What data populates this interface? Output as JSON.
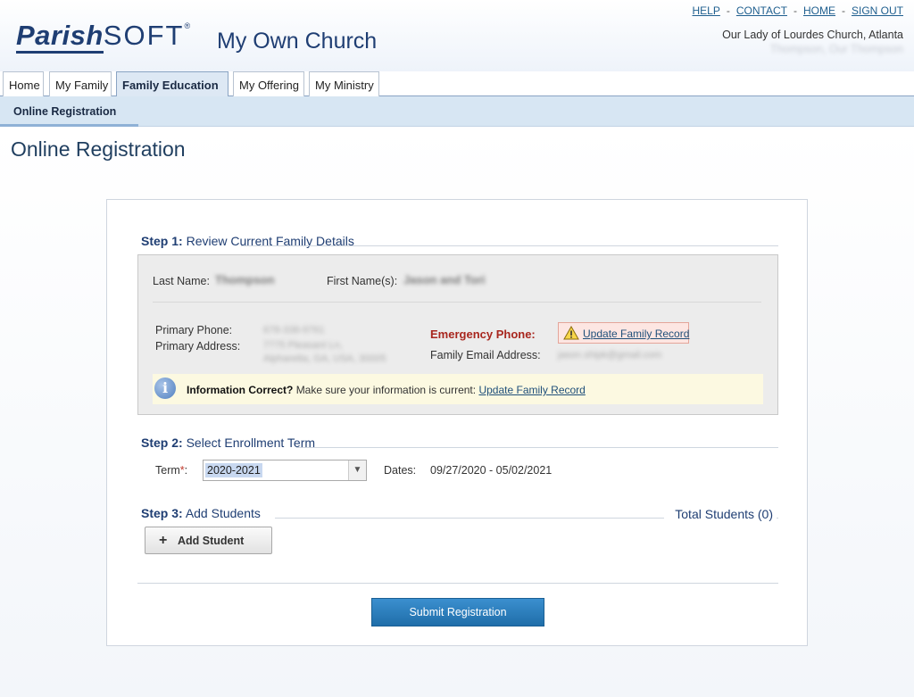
{
  "header": {
    "logo_parish": "Parish",
    "logo_soft": "SOFT",
    "logo_reg": "®",
    "church_title": "My Own Church",
    "links": [
      "HELP",
      "CONTACT",
      "HOME",
      "SIGN OUT"
    ],
    "link_separator": "-",
    "church_name": "Our Lady of Lourdes Church, Atlanta",
    "user_name": "Thompson, Our Thompson"
  },
  "tabs": [
    {
      "label": "Home"
    },
    {
      "label": "My Family"
    },
    {
      "label": "Family Education",
      "active": true
    },
    {
      "label": "My Offering"
    },
    {
      "label": "My Ministry"
    }
  ],
  "subnav": {
    "label": "Online Registration"
  },
  "page": {
    "title": "Online Registration"
  },
  "step1": {
    "number": "Step 1:",
    "title": "Review Current Family Details",
    "last_name_label": "Last Name:",
    "last_name_value": "Thompson",
    "first_names_label": "First Name(s):",
    "first_names_value": "Jason and Tori",
    "primary_phone_label": "Primary Phone:",
    "primary_phone_value": "678-338-9761",
    "primary_address_label": "Primary Address:",
    "primary_address_line1": "7775 Pleasant Ln,",
    "primary_address_line2": "Alpharetta, GA, USA, 30005",
    "emergency_label": "Emergency Phone:",
    "update_link": "Update Family Record",
    "email_label": "Family Email Address:",
    "email_value": "jason.shipk@gmail.com",
    "info_bold": "Information Correct?",
    "info_text": "Make sure your information is current:",
    "info_link": "Update Family Record"
  },
  "step2": {
    "number": "Step 2:",
    "title": "Select Enrollment Term",
    "term_label": "Term",
    "required_mark": "*",
    "term_colon": ":",
    "term_value": "2020-2021",
    "dates_label": "Dates:",
    "dates_value": "09/27/2020 - 05/02/2021"
  },
  "step3": {
    "number": "Step 3:",
    "title": "Add Students",
    "total_students": "Total Students (0)",
    "add_student_button": "Add Student",
    "plus_glyph": "+"
  },
  "submit_button": "Submit Registration",
  "colors": {
    "brand_blue": "#1f3e73",
    "submit_blue": "#2b7dbc",
    "emergency_red": "#a8261e"
  },
  "icons": {
    "warning": "warning-triangle-icon",
    "info": "info-circle-icon",
    "plus": "plus-icon"
  }
}
